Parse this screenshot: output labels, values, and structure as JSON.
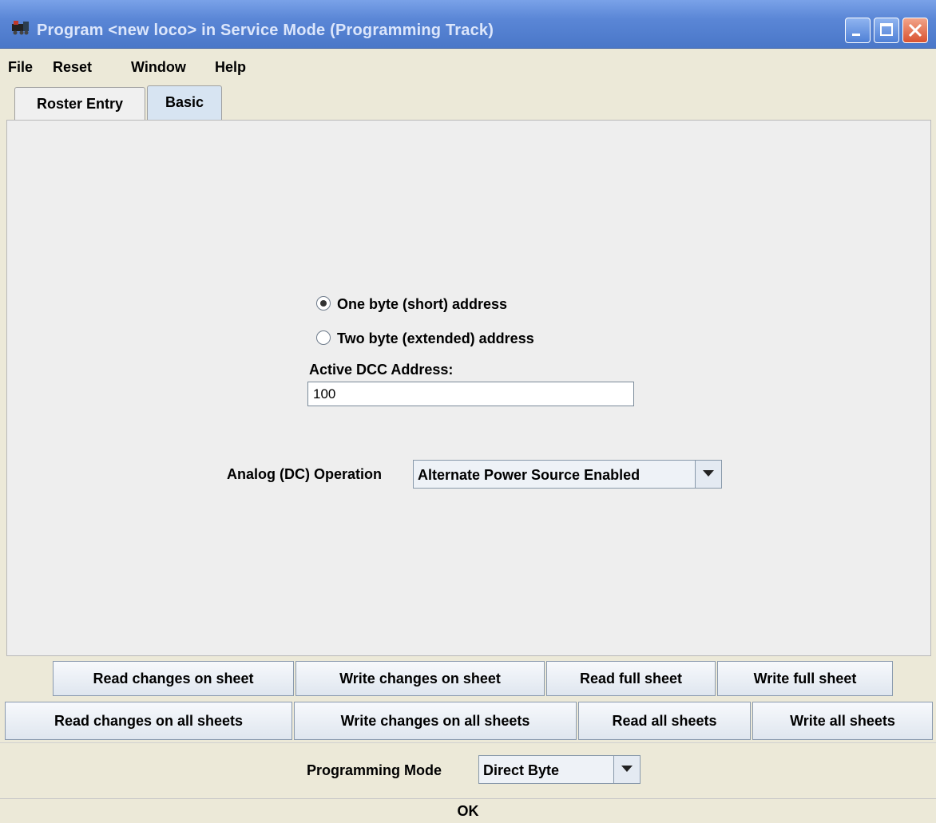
{
  "window": {
    "title": "Program <new loco> in Service Mode (Programming Track)",
    "icon": "locomotive-icon",
    "controls": [
      "minimize-icon",
      "maximize-icon",
      "close-icon"
    ]
  },
  "menubar": {
    "items": [
      "File",
      "Reset",
      "Window",
      "Help"
    ]
  },
  "tabs": [
    {
      "label": "Roster Entry",
      "active": false
    },
    {
      "label": "Basic",
      "active": true
    }
  ],
  "basic": {
    "address_options": [
      {
        "label": "One byte (short) address",
        "selected": true
      },
      {
        "label": "Two byte (extended) address",
        "selected": false
      }
    ],
    "dcc_address_label": "Active DCC Address:",
    "dcc_address_value": "100",
    "analog_label": "Analog (DC) Operation",
    "analog_value": "Alternate Power Source Enabled"
  },
  "buttons": {
    "read_changes_sheet": "Read changes on sheet",
    "write_changes_sheet": "Write changes on sheet",
    "read_full_sheet": "Read full sheet",
    "write_full_sheet": "Write full sheet",
    "read_changes_all": "Read changes on all sheets",
    "write_changes_all": "Write changes on all sheets",
    "read_all": "Read all sheets",
    "write_all": "Write all sheets"
  },
  "programming_mode": {
    "label": "Programming Mode",
    "value": "Direct Byte"
  },
  "status": "OK"
}
